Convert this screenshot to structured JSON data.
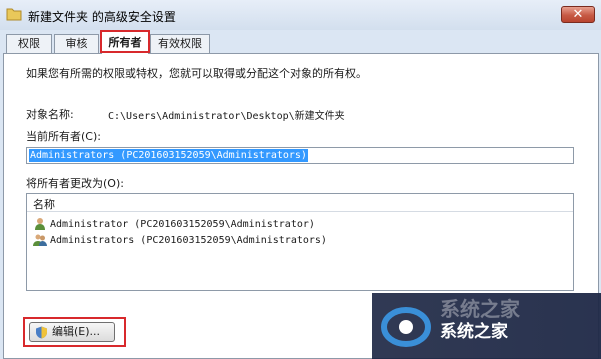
{
  "window": {
    "title": "新建文件夹 的高级安全设置",
    "close_glyph": "✕"
  },
  "tabs": [
    {
      "label": "权限",
      "active": false
    },
    {
      "label": "审核",
      "active": false
    },
    {
      "label": "所有者",
      "active": true
    },
    {
      "label": "有效权限",
      "active": false
    }
  ],
  "owner_tab": {
    "intro": "如果您有所需的权限或特权，您就可以取得或分配这个对象的所有权。",
    "object_name_label": "对象名称:",
    "object_name_value": "C:\\Users\\Administrator\\Desktop\\新建文件夹",
    "current_owner_label": "当前所有者(C):",
    "current_owner_value": "Administrators (PC201603152059\\Administrators)",
    "change_owner_label": "将所有者更改为(O):",
    "list_header": "名称",
    "list_items": [
      {
        "name": "Administrator (PC201603152059\\Administrator)",
        "icon": "single-user-icon"
      },
      {
        "name": "Administrators (PC201603152059\\Administrators)",
        "icon": "user-group-icon"
      }
    ],
    "edit_button": "编辑(E)..."
  },
  "watermark": {
    "text": "系统之家",
    "faint_text": "系统之家"
  },
  "colors": {
    "accent_highlight": "#d8292c",
    "selection": "#3399ff",
    "close_button": "#c75a45"
  }
}
